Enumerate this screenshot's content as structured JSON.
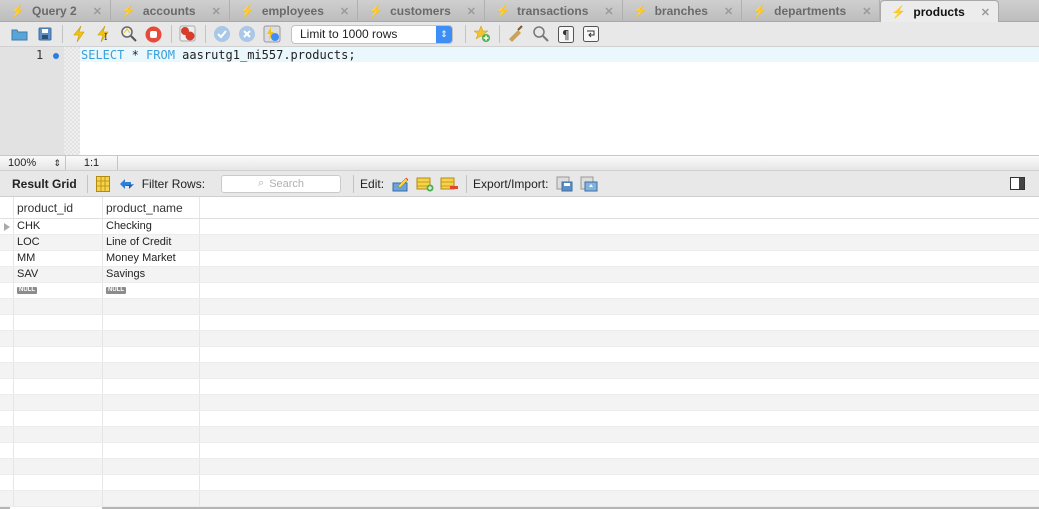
{
  "tabs": [
    {
      "label": "Query 2",
      "active": false
    },
    {
      "label": "accounts",
      "active": false
    },
    {
      "label": "employees",
      "active": false
    },
    {
      "label": "customers",
      "active": false
    },
    {
      "label": "transactions",
      "active": false
    },
    {
      "label": "branches",
      "active": false
    },
    {
      "label": "departments",
      "active": false
    },
    {
      "label": "products",
      "active": true
    }
  ],
  "toolbar": {
    "icons": [
      "open-folder-icon",
      "save-icon",
      "execute-icon",
      "execute-current-icon",
      "explain-icon",
      "stop-icon",
      "toggle-error-icon",
      "commit-icon",
      "rollback-icon",
      "autocommit-icon"
    ],
    "limit_select": "Limit to 1000 rows",
    "right_icons": [
      "add-snippet-icon",
      "beautify-icon",
      "find-icon",
      "invisible-chars-icon",
      "wrap-icon"
    ]
  },
  "editor": {
    "line_number": "1",
    "code_keyword1": "SELECT",
    "code_mid": " * ",
    "code_keyword2": "FROM",
    "code_rest": " aasrutg1_mi557.products;"
  },
  "status": {
    "zoom": "100%",
    "position": "1:1"
  },
  "result_toolbar": {
    "result_grid_label": "Result Grid",
    "filter_label": "Filter Rows:",
    "search_placeholder": "Search",
    "edit_label": "Edit:",
    "export_label": "Export/Import:"
  },
  "grid": {
    "columns": [
      "product_id",
      "product_name"
    ],
    "rows": [
      [
        "CHK",
        "Checking"
      ],
      [
        "LOC",
        "Line of Credit"
      ],
      [
        "MM",
        "Money Market"
      ],
      [
        "SAV",
        "Savings"
      ]
    ],
    "null_label": "NULL"
  },
  "colors": {
    "keyword": "#3aa0d8",
    "accent": "#3d8ef5"
  }
}
